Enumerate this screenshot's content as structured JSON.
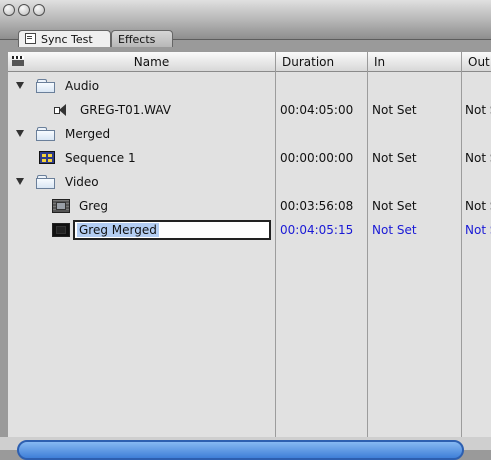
{
  "tabs": [
    {
      "label": "Sync Test",
      "active": true,
      "icon": "bin-icon"
    },
    {
      "label": "Effects",
      "active": false
    }
  ],
  "columns": {
    "name": "Name",
    "duration": "Duration",
    "in": "In",
    "out": "Out"
  },
  "rows": [
    {
      "name": "Audio",
      "type": "folder",
      "expanded": true,
      "duration": "",
      "in": "",
      "out": ""
    },
    {
      "name": "GREG-T01.WAV",
      "type": "audio-clip",
      "duration": "00:04:05:00",
      "in": "Not Set",
      "out": "Not Set"
    },
    {
      "name": "Merged",
      "type": "folder",
      "expanded": true,
      "duration": "",
      "in": "",
      "out": ""
    },
    {
      "name": "Sequence 1",
      "type": "sequence",
      "duration": "00:00:00:00",
      "in": "Not Set",
      "out": "Not Set"
    },
    {
      "name": "Video",
      "type": "folder",
      "expanded": true,
      "duration": "",
      "in": "",
      "out": ""
    },
    {
      "name": "Greg",
      "type": "video-clip",
      "duration": "00:03:56:08",
      "in": "Not Set",
      "out": "Not Set"
    },
    {
      "name": "Greg Merged",
      "type": "merged-clip",
      "selected": true,
      "editing": true,
      "duration": "00:04:05:15",
      "in": "Not Set",
      "out": "Not Set"
    }
  ],
  "colors": {
    "selected_text": "#1a1ad6",
    "list_bg": "#e1e1e1",
    "edit_highlight": "#b3cdf2"
  }
}
